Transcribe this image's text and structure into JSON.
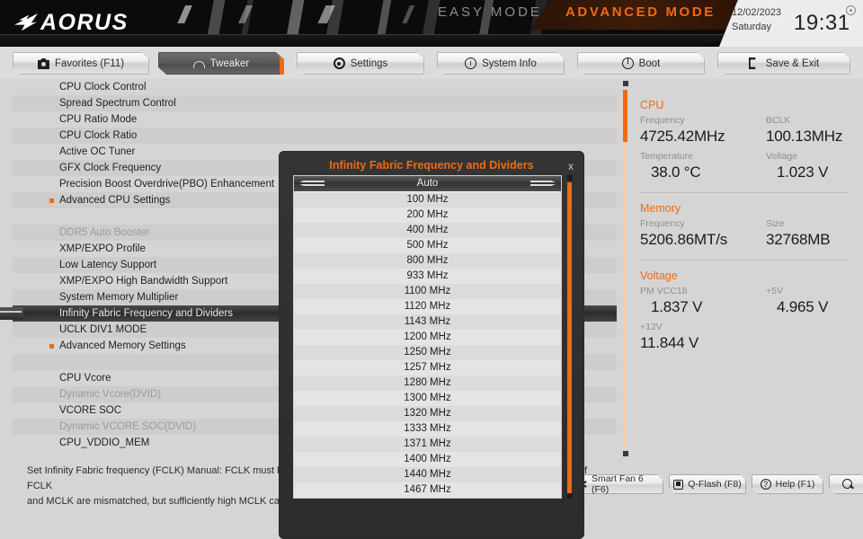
{
  "header": {
    "brand": "AORUS",
    "easy_mode": "EASY MODE",
    "advanced_mode": "ADVANCED MODE",
    "date": "12/02/2023",
    "weekday": "Saturday",
    "time": "19:31",
    "accent_color": "#f06a10"
  },
  "tabs": [
    {
      "label": "Favorites (F11)",
      "icon": "camera-icon",
      "active": false
    },
    {
      "label": "Tweaker",
      "icon": "gauge-icon",
      "active": true
    },
    {
      "label": "Settings",
      "icon": "gear-icon",
      "active": false
    },
    {
      "label": "System Info",
      "icon": "info-icon",
      "active": false
    },
    {
      "label": "Boot",
      "icon": "power-icon",
      "active": false
    },
    {
      "label": "Save & Exit",
      "icon": "exit-icon",
      "active": false
    }
  ],
  "menu": [
    {
      "label": "CPU Clock Control",
      "state": "normal"
    },
    {
      "label": "Spread Spectrum Control",
      "state": "normal"
    },
    {
      "label": "CPU Ratio Mode",
      "state": "normal"
    },
    {
      "label": "CPU Clock Ratio",
      "state": "normal"
    },
    {
      "label": "Active OC Tuner",
      "state": "normal"
    },
    {
      "label": "GFX Clock Frequency",
      "state": "normal"
    },
    {
      "label": "Precision Boost Overdrive(PBO) Enhancement",
      "state": "normal"
    },
    {
      "label": "Advanced CPU Settings",
      "state": "submenu"
    },
    {
      "label": "",
      "state": "spacer"
    },
    {
      "label": "DDR5 Auto Booster",
      "state": "disabled"
    },
    {
      "label": "XMP/EXPO Profile",
      "state": "normal"
    },
    {
      "label": "Low Latency Support",
      "state": "normal"
    },
    {
      "label": "XMP/EXPO High Bandwidth Support",
      "state": "normal"
    },
    {
      "label": "System Memory Multiplier",
      "state": "normal"
    },
    {
      "label": "Infinity Fabric Frequency and Dividers",
      "state": "selected"
    },
    {
      "label": "UCLK DIV1 MODE",
      "state": "normal"
    },
    {
      "label": "Advanced Memory Settings",
      "state": "submenu"
    },
    {
      "label": "",
      "state": "spacer"
    },
    {
      "label": "CPU Vcore",
      "state": "normal"
    },
    {
      "label": "Dynamic Vcore(DVID)",
      "state": "disabled"
    },
    {
      "label": "VCORE SOC",
      "state": "normal"
    },
    {
      "label": "Dynamic VCORE SOC(DVID)",
      "state": "disabled"
    },
    {
      "label": "CPU_VDDIO_MEM",
      "state": "normal"
    }
  ],
  "dialog": {
    "title": "Infinity Fabric Frequency and Dividers",
    "close_label": "x",
    "selected": "Auto",
    "options": [
      "Auto",
      "100 MHz",
      "200 MHz",
      "400 MHz",
      "500 MHz",
      "800 MHz",
      "933 MHz",
      "1100 MHz",
      "1120 MHz",
      "1143 MHz",
      "1200 MHz",
      "1250 MHz",
      "1257 MHz",
      "1280 MHz",
      "1300 MHz",
      "1320 MHz",
      "1333 MHz",
      "1371 MHz",
      "1400 MHz",
      "1440 MHz",
      "1467 MHz"
    ]
  },
  "info": {
    "cpu": {
      "title": "CPU",
      "frequency_label": "Frequency",
      "frequency_value": "4725.42MHz",
      "bclk_label": "BCLK",
      "bclk_value": "100.13MHz",
      "temperature_label": "Temperature",
      "temperature_value": "38.0 °C",
      "voltage_label": "Voltage",
      "voltage_value": "1.023 V"
    },
    "memory": {
      "title": "Memory",
      "frequency_label": "Frequency",
      "frequency_value": "5206.86MT/s",
      "size_label": "Size",
      "size_value": "32768MB"
    },
    "voltage": {
      "title": "Voltage",
      "pm_vcc18_label": "PM VCC18",
      "pm_vcc18_value": "1.837 V",
      "v5_label": "+5V",
      "v5_value": "4.965 V",
      "v12_label": "+12V",
      "v12_value": "11.844 V"
    }
  },
  "help": {
    "line1": "Set Infinity Fabric frequency (FCLK) Manual: FCLK must be less than or equal to MCLK to avoid a latency penalty or instability if FCLK",
    "line2": "and MCLK are mismatched, but sufficiently high MCLK can negate or overcome this penalty."
  },
  "footer_buttons": [
    {
      "label": "Smart Fan 6 (F6)",
      "icon": "fan-icon"
    },
    {
      "label": "Q-Flash (F8)",
      "icon": "qflash-icon"
    },
    {
      "label": "Help (F1)",
      "icon": "question-icon"
    },
    {
      "label": "",
      "icon": "search-icon"
    }
  ]
}
